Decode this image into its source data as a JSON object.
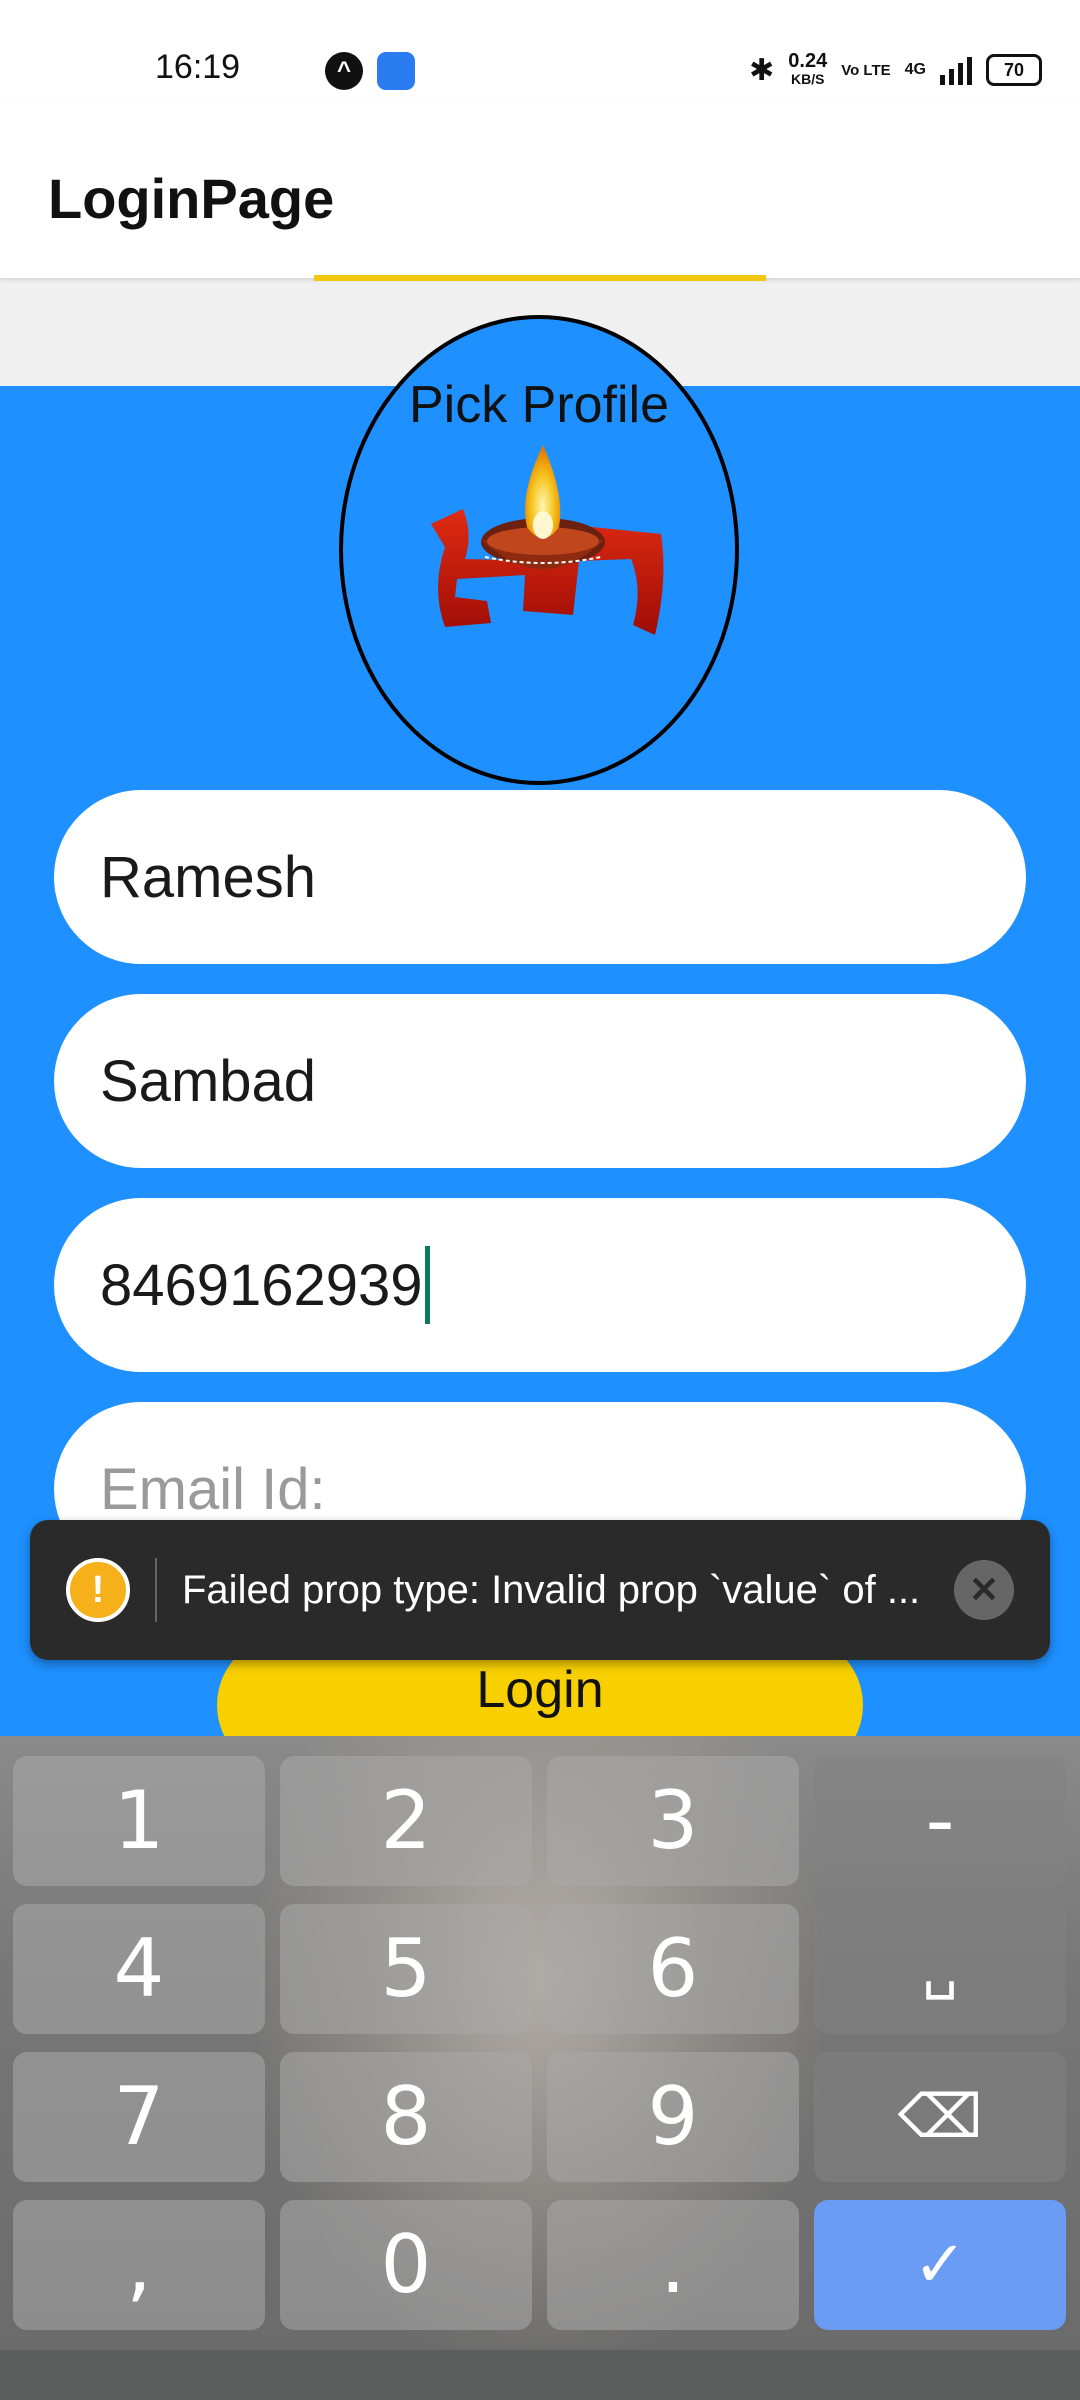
{
  "status_bar": {
    "time": "16:19",
    "speed_value": "0.24",
    "speed_unit": "KB/S",
    "volte": "Vo LTE",
    "network": "4G",
    "battery": "70"
  },
  "app_bar": {
    "title": "LoginPage"
  },
  "profile": {
    "label": "Pick Profile",
    "image_icon": "diya-swastika-image"
  },
  "form": {
    "first_name_value": "Ramesh",
    "last_name_value": "Sambad",
    "phone_value": "8469162939",
    "email_placeholder": "Email Id:",
    "login_label": "Login"
  },
  "toast": {
    "icon": "warning-icon",
    "message": "Failed prop type: Invalid prop `value` of ..."
  },
  "keyboard": {
    "keys": [
      "1",
      "2",
      "3",
      "-",
      "4",
      "5",
      "6",
      "␣",
      "7",
      "8",
      "9",
      "⌫",
      ",",
      "0",
      ".",
      "✓"
    ]
  },
  "colors": {
    "accent_blue": "#1e90ff",
    "button_yellow": "#f8d000",
    "toast_bg": "#2a2a2a",
    "done_key": "#6a9cf4"
  }
}
